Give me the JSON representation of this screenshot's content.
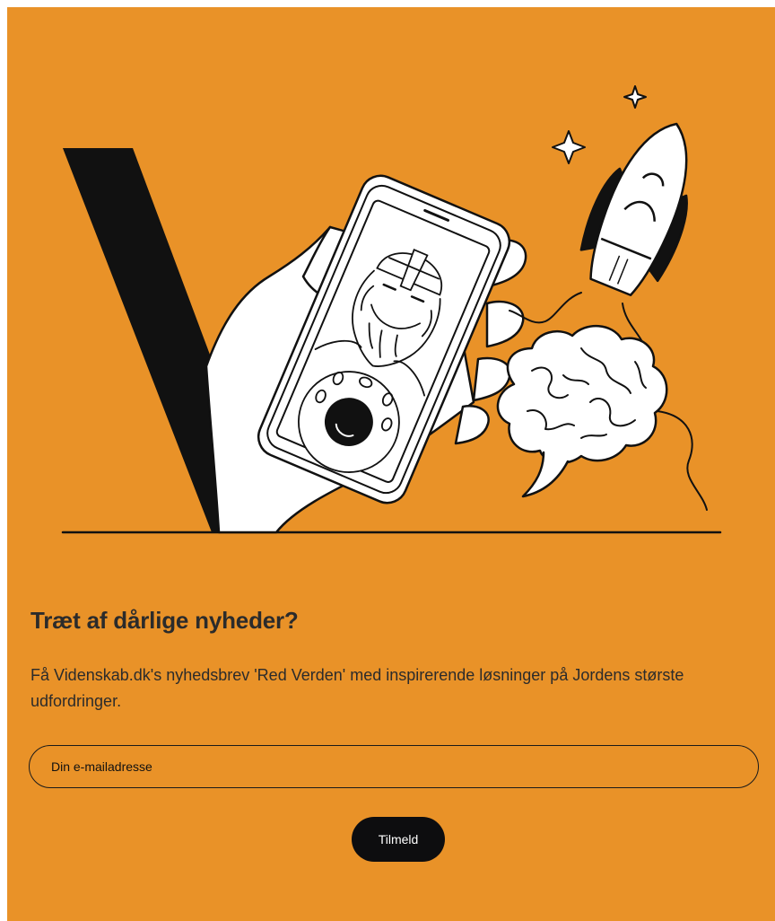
{
  "newsletter": {
    "headline": "Træt af dårlige nyheder?",
    "description": "Få Videnskab.dk's nyhedsbrev 'Red Verden' med inspirerende løsninger på Jordens største udfordringer.",
    "email_placeholder": "Din e-mailadresse",
    "submit_label": "Tilmeld"
  },
  "colors": {
    "background": "#E99228",
    "text": "#2b2b2b",
    "button": "#0d0d0f",
    "button_text": "#ffffff"
  },
  "illustration": {
    "elements": [
      "v-logo-shape",
      "hand",
      "phone",
      "viking-portrait",
      "rocket",
      "brain",
      "sparkle-icon"
    ]
  }
}
